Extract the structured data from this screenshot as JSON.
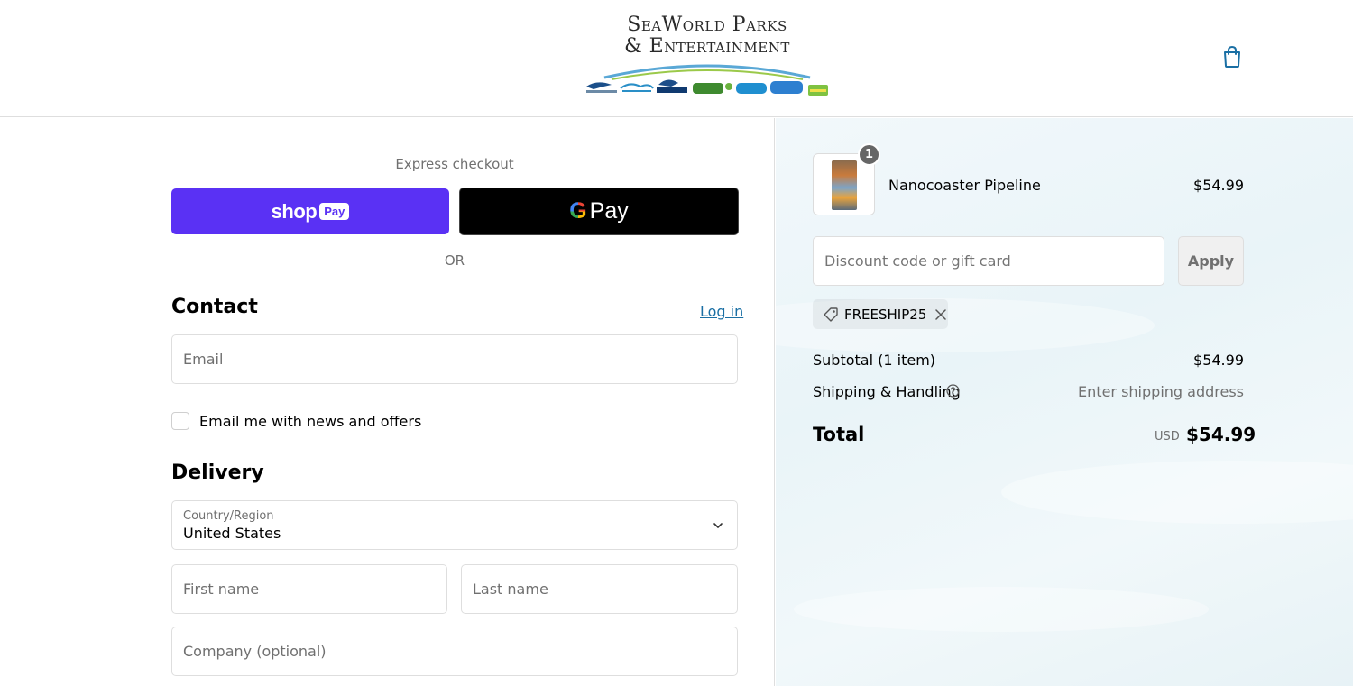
{
  "header": {
    "logo_line1": "SeaWorld Parks",
    "logo_line2": "& Entertainment",
    "logo_alt": "SeaWorld Parks & Entertainment",
    "cart_icon": "bag-icon"
  },
  "express": {
    "label": "Express checkout",
    "shop_pay_word": "shop",
    "shop_pay_pill": "Pay",
    "gpay_g": "G",
    "gpay_word": "Pay",
    "divider": "OR"
  },
  "contact": {
    "title": "Contact",
    "login": "Log in",
    "email_placeholder": "Email",
    "newsletter_label": "Email me with news and offers",
    "newsletter_checked": false
  },
  "delivery": {
    "title": "Delivery",
    "country_label": "Country/Region",
    "country_value": "United States",
    "first_name_placeholder": "First name",
    "last_name_placeholder": "Last name",
    "company_placeholder": "Company (optional)"
  },
  "order": {
    "item": {
      "quantity": "1",
      "name": "Nanocoaster Pipeline",
      "price": "$54.99"
    },
    "discount_placeholder": "Discount code or gift card",
    "apply_label": "Apply",
    "applied_code": "FREESHIP25",
    "subtotal_label": "Subtotal (1 item)",
    "subtotal_value": "$54.99",
    "shipping_label": "Shipping & Handling",
    "shipping_value": "Enter shipping address",
    "total_label": "Total",
    "total_currency": "USD",
    "total_value": "$54.99"
  },
  "colors": {
    "shop_pay": "#5a31f4",
    "link": "#1a6fa4",
    "panel_bg": "#eef6f9",
    "border": "#dedede"
  }
}
